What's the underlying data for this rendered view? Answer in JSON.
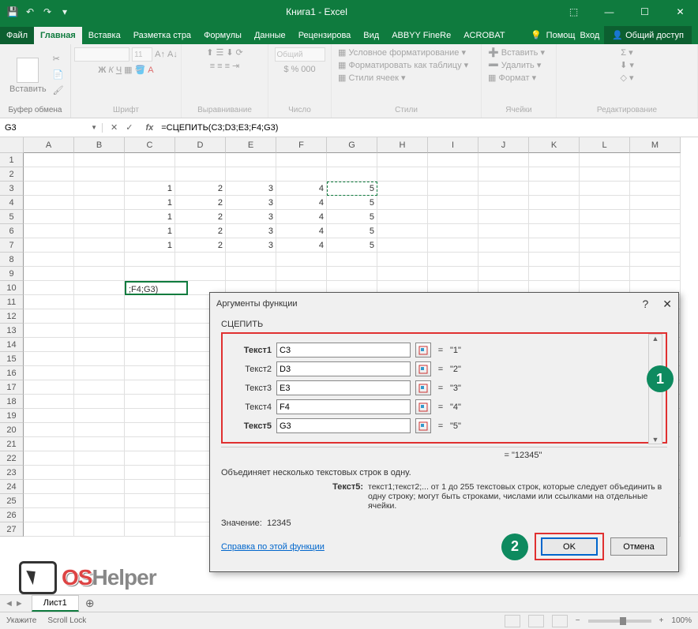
{
  "titlebar": {
    "title": "Книга1 - Excel"
  },
  "tabs": {
    "file": "Файл",
    "items": [
      "Главная",
      "Вставка",
      "Разметка стра",
      "Формулы",
      "Данные",
      "Рецензирова",
      "Вид",
      "ABBYY FineRe",
      "ACROBAT"
    ],
    "active_index": 0,
    "help": "Помощ",
    "signin": "Вход",
    "share": "Общий доступ"
  },
  "ribbon": {
    "clipboard": {
      "paste": "Вставить",
      "label": "Буфер обмена"
    },
    "font": {
      "label": "Шрифт",
      "size": "11",
      "bold": "Ж",
      "italic": "К",
      "underline": "Ч"
    },
    "alignment": {
      "label": "Выравнивание"
    },
    "number": {
      "format": "Общий",
      "label": "Число"
    },
    "styles": {
      "conditional": "Условное форматирование",
      "table": "Форматировать как таблицу",
      "cell": "Стили ячеек",
      "label": "Стили"
    },
    "cells": {
      "insert": "Вставить",
      "delete": "Удалить",
      "format": "Формат",
      "label": "Ячейки"
    },
    "editing": {
      "label": "Редактирование"
    }
  },
  "namebox": "G3",
  "formula": "=СЦЕПИТЬ(C3;D3;E3;F4;G3)",
  "columns": [
    "A",
    "B",
    "C",
    "D",
    "E",
    "F",
    "G",
    "H",
    "I",
    "J",
    "K",
    "L",
    "M"
  ],
  "rows_visible": 27,
  "grid_data": {
    "C3": "1",
    "D3": "2",
    "E3": "3",
    "F3": "4",
    "G3": "5",
    "C4": "1",
    "D4": "2",
    "E4": "3",
    "F4": "4",
    "G4": "5",
    "C5": "1",
    "D5": "2",
    "E5": "3",
    "F5": "4",
    "G5": "5",
    "C6": "1",
    "D6": "2",
    "E6": "3",
    "F6": "4",
    "G6": "5",
    "C7": "1",
    "D7": "2",
    "E7": "3",
    "F7": "4",
    "G7": "5",
    "C10": ";F4;G3)"
  },
  "dialog": {
    "title": "Аргументы функции",
    "func": "СЦЕПИТЬ",
    "args": [
      {
        "label": "Текст1",
        "value": "C3",
        "result": "\"1\"",
        "bold": true
      },
      {
        "label": "Текст2",
        "value": "D3",
        "result": "\"2\"",
        "bold": false
      },
      {
        "label": "Текст3",
        "value": "E3",
        "result": "\"3\"",
        "bold": false
      },
      {
        "label": "Текст4",
        "value": "F4",
        "result": "\"4\"",
        "bold": false
      },
      {
        "label": "Текст5",
        "value": "G3",
        "result": "\"5\"",
        "bold": true
      }
    ],
    "result_top": "= \"12345\"",
    "desc": "Объединяет несколько текстовых строк в одну.",
    "arg_help_label": "Текст5:",
    "arg_help_text": "текст1;текст2;... от 1 до 255 текстовых строк, которые следует объединить в одну строку; могут быть строками, числами или ссылками на отдельные ячейки.",
    "value_label": "Значение:",
    "value": "12345",
    "help_link": "Справка по этой функции",
    "ok": "OK",
    "cancel": "Отмена"
  },
  "sheet": {
    "name": "Лист1"
  },
  "status": {
    "mode": "Укажите",
    "scroll": "Scroll Lock",
    "zoom": "100%"
  },
  "watermark": {
    "os": "OS",
    "helper": "Helper"
  },
  "callouts": {
    "one": "1",
    "two": "2"
  }
}
